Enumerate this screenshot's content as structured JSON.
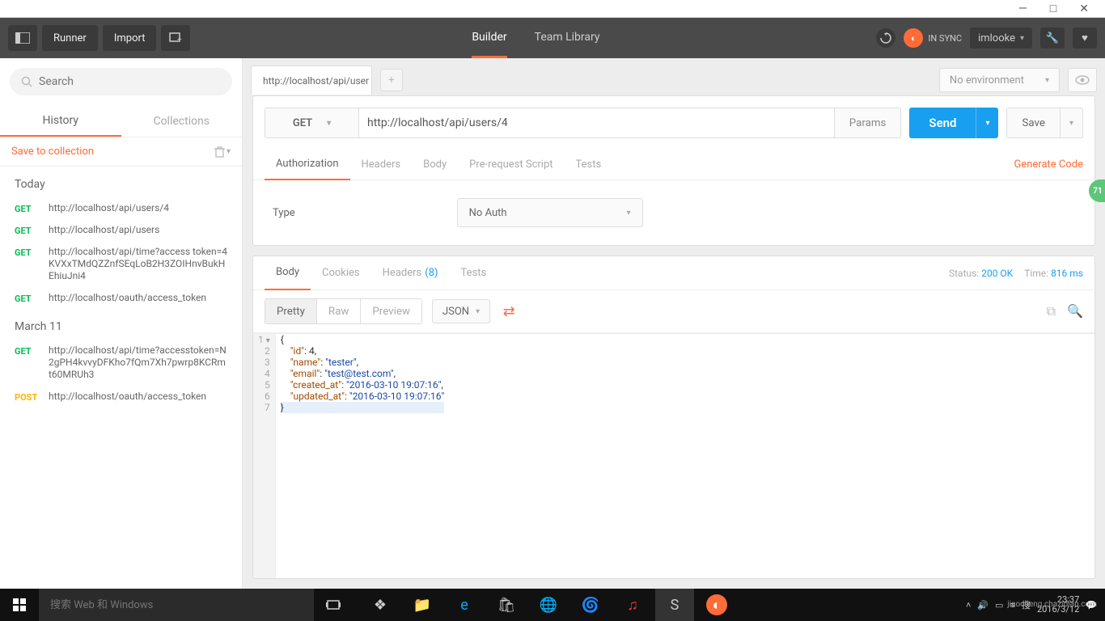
{
  "window_controls": {
    "minimize": "—",
    "maximize": "□",
    "close": "✕"
  },
  "topbar": {
    "runner": "Runner",
    "import": "Import",
    "builder": "Builder",
    "team_library": "Team Library",
    "sync_text": "IN SYNC",
    "username": "imlooke"
  },
  "sidebar": {
    "search_placeholder": "Search",
    "tabs": {
      "history": "History",
      "collections": "Collections"
    },
    "save_to": "Save to collection",
    "groups": [
      {
        "label": "Today",
        "items": [
          {
            "method": "GET",
            "url": "http://localhost/api/users/4"
          },
          {
            "method": "GET",
            "url": "http://localhost/api/users"
          },
          {
            "method": "GET",
            "url": "http://localhost/api/time?access token=4KVXxTMdQZZnfSEqLoB2H3ZOIHnvBukHEhiuJni4"
          },
          {
            "method": "GET",
            "url": "http://localhost/oauth/access_token"
          }
        ]
      },
      {
        "label": "March 11",
        "items": [
          {
            "method": "GET",
            "url": "http://localhost/api/time?accesstoken=N2gPH4kvvyDFKho7fQm7Xh7pwrp8KCRmt60MRUh3"
          },
          {
            "method": "POST",
            "url": "http://localhost/oauth/access_token"
          }
        ]
      }
    ]
  },
  "request": {
    "tab_label": "http://localhost/api/user",
    "env_placeholder": "No environment",
    "method": "GET",
    "url": "http://localhost/api/users/4",
    "params_btn": "Params",
    "send_btn": "Send",
    "save_btn": "Save",
    "subtabs": {
      "auth": "Authorization",
      "headers": "Headers",
      "body": "Body",
      "prereq": "Pre-request Script",
      "tests": "Tests"
    },
    "generate_code": "Generate Code",
    "auth": {
      "type_label": "Type",
      "selected": "No Auth"
    }
  },
  "response": {
    "tabs": {
      "body": "Body",
      "cookies": "Cookies",
      "headers": "Headers",
      "headers_count": "(8)",
      "tests": "Tests"
    },
    "status_label": "Status:",
    "status": "200 OK",
    "time_label": "Time:",
    "time": "816 ms",
    "views": {
      "pretty": "Pretty",
      "raw": "Raw",
      "preview": "Preview",
      "format": "JSON"
    },
    "code": {
      "l1": "{",
      "l2_k": "\"id\"",
      "l2_v": "4",
      "l2_c": ",",
      "l3_k": "\"name\"",
      "l3_v": "\"tester\"",
      "l3_c": ",",
      "l4_k": "\"email\"",
      "l4_v": "\"test@test.com\"",
      "l4_c": ",",
      "l5_k": "\"created_at\"",
      "l5_v": "\"2016-03-10 19:07:16\"",
      "l5_c": ",",
      "l6_k": "\"updated_at\"",
      "l6_v": "\"2016-03-10 19:07:16\"",
      "l7": "}"
    }
  },
  "taskbar": {
    "cortana_placeholder": "搜索 Web 和 Windows",
    "time": "23:37",
    "date": "2016/3/12",
    "watermark": "jiaocheng.chazidian.com"
  },
  "float_badge": "71"
}
